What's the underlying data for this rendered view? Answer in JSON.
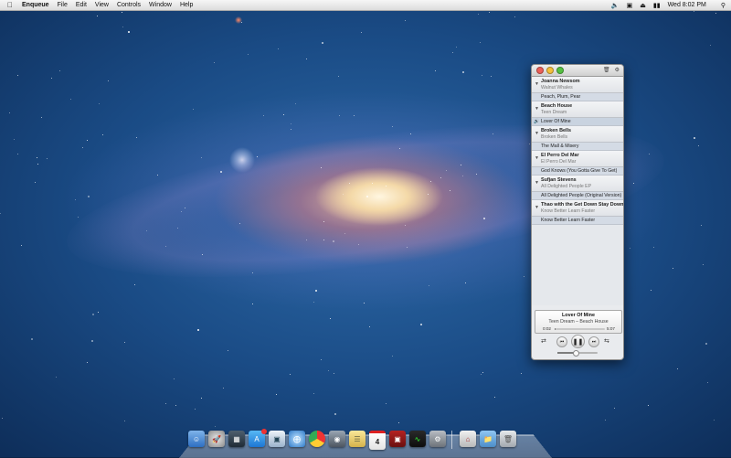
{
  "menubar": {
    "app_name": "Enqueue",
    "items": [
      "File",
      "Edit",
      "View",
      "Controls",
      "Window",
      "Help"
    ],
    "clock": "Wed 8:02 PM"
  },
  "window": {
    "albums": [
      {
        "artist": "Joanna Newsom",
        "album": "Walnut Whales",
        "tracks": [
          "Peach, Plum, Pear"
        ]
      },
      {
        "artist": "Beach House",
        "album": "Teen Dream",
        "tracks": [
          "Lover Of Mine"
        ]
      },
      {
        "artist": "Broken Bells",
        "album": "Broken Bells",
        "tracks": [
          "The Mall & Misery"
        ]
      },
      {
        "artist": "El Perro Del Mar",
        "album": "El Perro Del Mar",
        "tracks": [
          "God Knows (You Gotta Give To Get)"
        ]
      },
      {
        "artist": "Sufjan Stevens",
        "album": "All Delighted People EP",
        "tracks": [
          "All Delighted People (Original Version)"
        ]
      },
      {
        "artist": "Thao with the Get Down Stay Down",
        "album": "Know Better Learn Faster",
        "tracks": [
          "Know Better Learn Faster"
        ]
      }
    ],
    "now_playing": {
      "title": "Lover Of Mine",
      "subtitle": "Teen Dream – Beach House",
      "elapsed": "0:02",
      "total": "5:07",
      "progress": 0.01,
      "volume": 0.45
    }
  },
  "dock": {
    "icons": [
      "finder-icon",
      "launchpad-icon",
      "mission-control-icon",
      "app-store-icon",
      "preview-icon",
      "safari-icon",
      "chrome-icon",
      "facetime-icon",
      "notes-icon",
      "calendar-icon",
      "photo-booth-icon",
      "activity-monitor-icon",
      "system-preferences-icon",
      "home-folder-icon",
      "documents-folder-icon",
      "trash-icon"
    ],
    "calendar_day": "4"
  }
}
